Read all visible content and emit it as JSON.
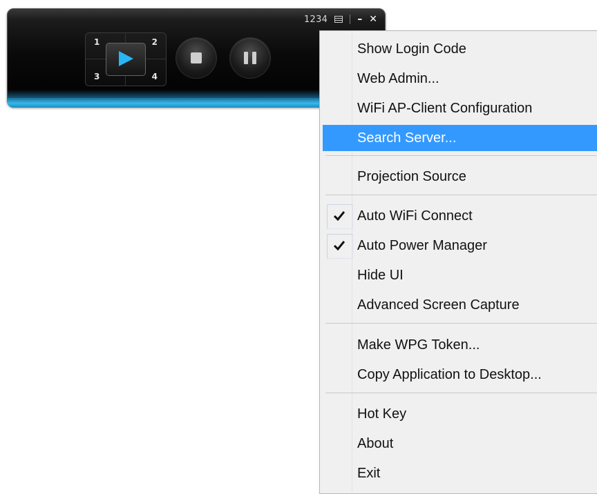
{
  "player": {
    "login_code": "1234",
    "quadrants": [
      "1",
      "2",
      "3",
      "4"
    ],
    "colors": {
      "accent": "#37b7ea",
      "body": "#000000"
    },
    "icons": [
      "grid-icon",
      "minimize-icon",
      "close-icon",
      "play-icon",
      "stop-icon",
      "pause-icon"
    ]
  },
  "menu": {
    "items": [
      {
        "label": "Show Login Code"
      },
      {
        "label": "Web Admin..."
      },
      {
        "label": "WiFi AP-Client Configuration"
      },
      {
        "label": "Search Server...",
        "selected": true
      },
      {
        "label": "Projection Source",
        "submenu": true
      },
      {
        "label": "Auto WiFi Connect",
        "checked": true
      },
      {
        "label": "Auto Power Manager",
        "checked": true
      },
      {
        "label": "Hide UI"
      },
      {
        "label": "Advanced Screen Capture"
      },
      {
        "label": "Make WPG Token..."
      },
      {
        "label": "Copy Application to Desktop..."
      },
      {
        "label": "Hot Key"
      },
      {
        "label": "About"
      },
      {
        "label": "Exit"
      }
    ],
    "highlight_color": "#3399ff"
  }
}
